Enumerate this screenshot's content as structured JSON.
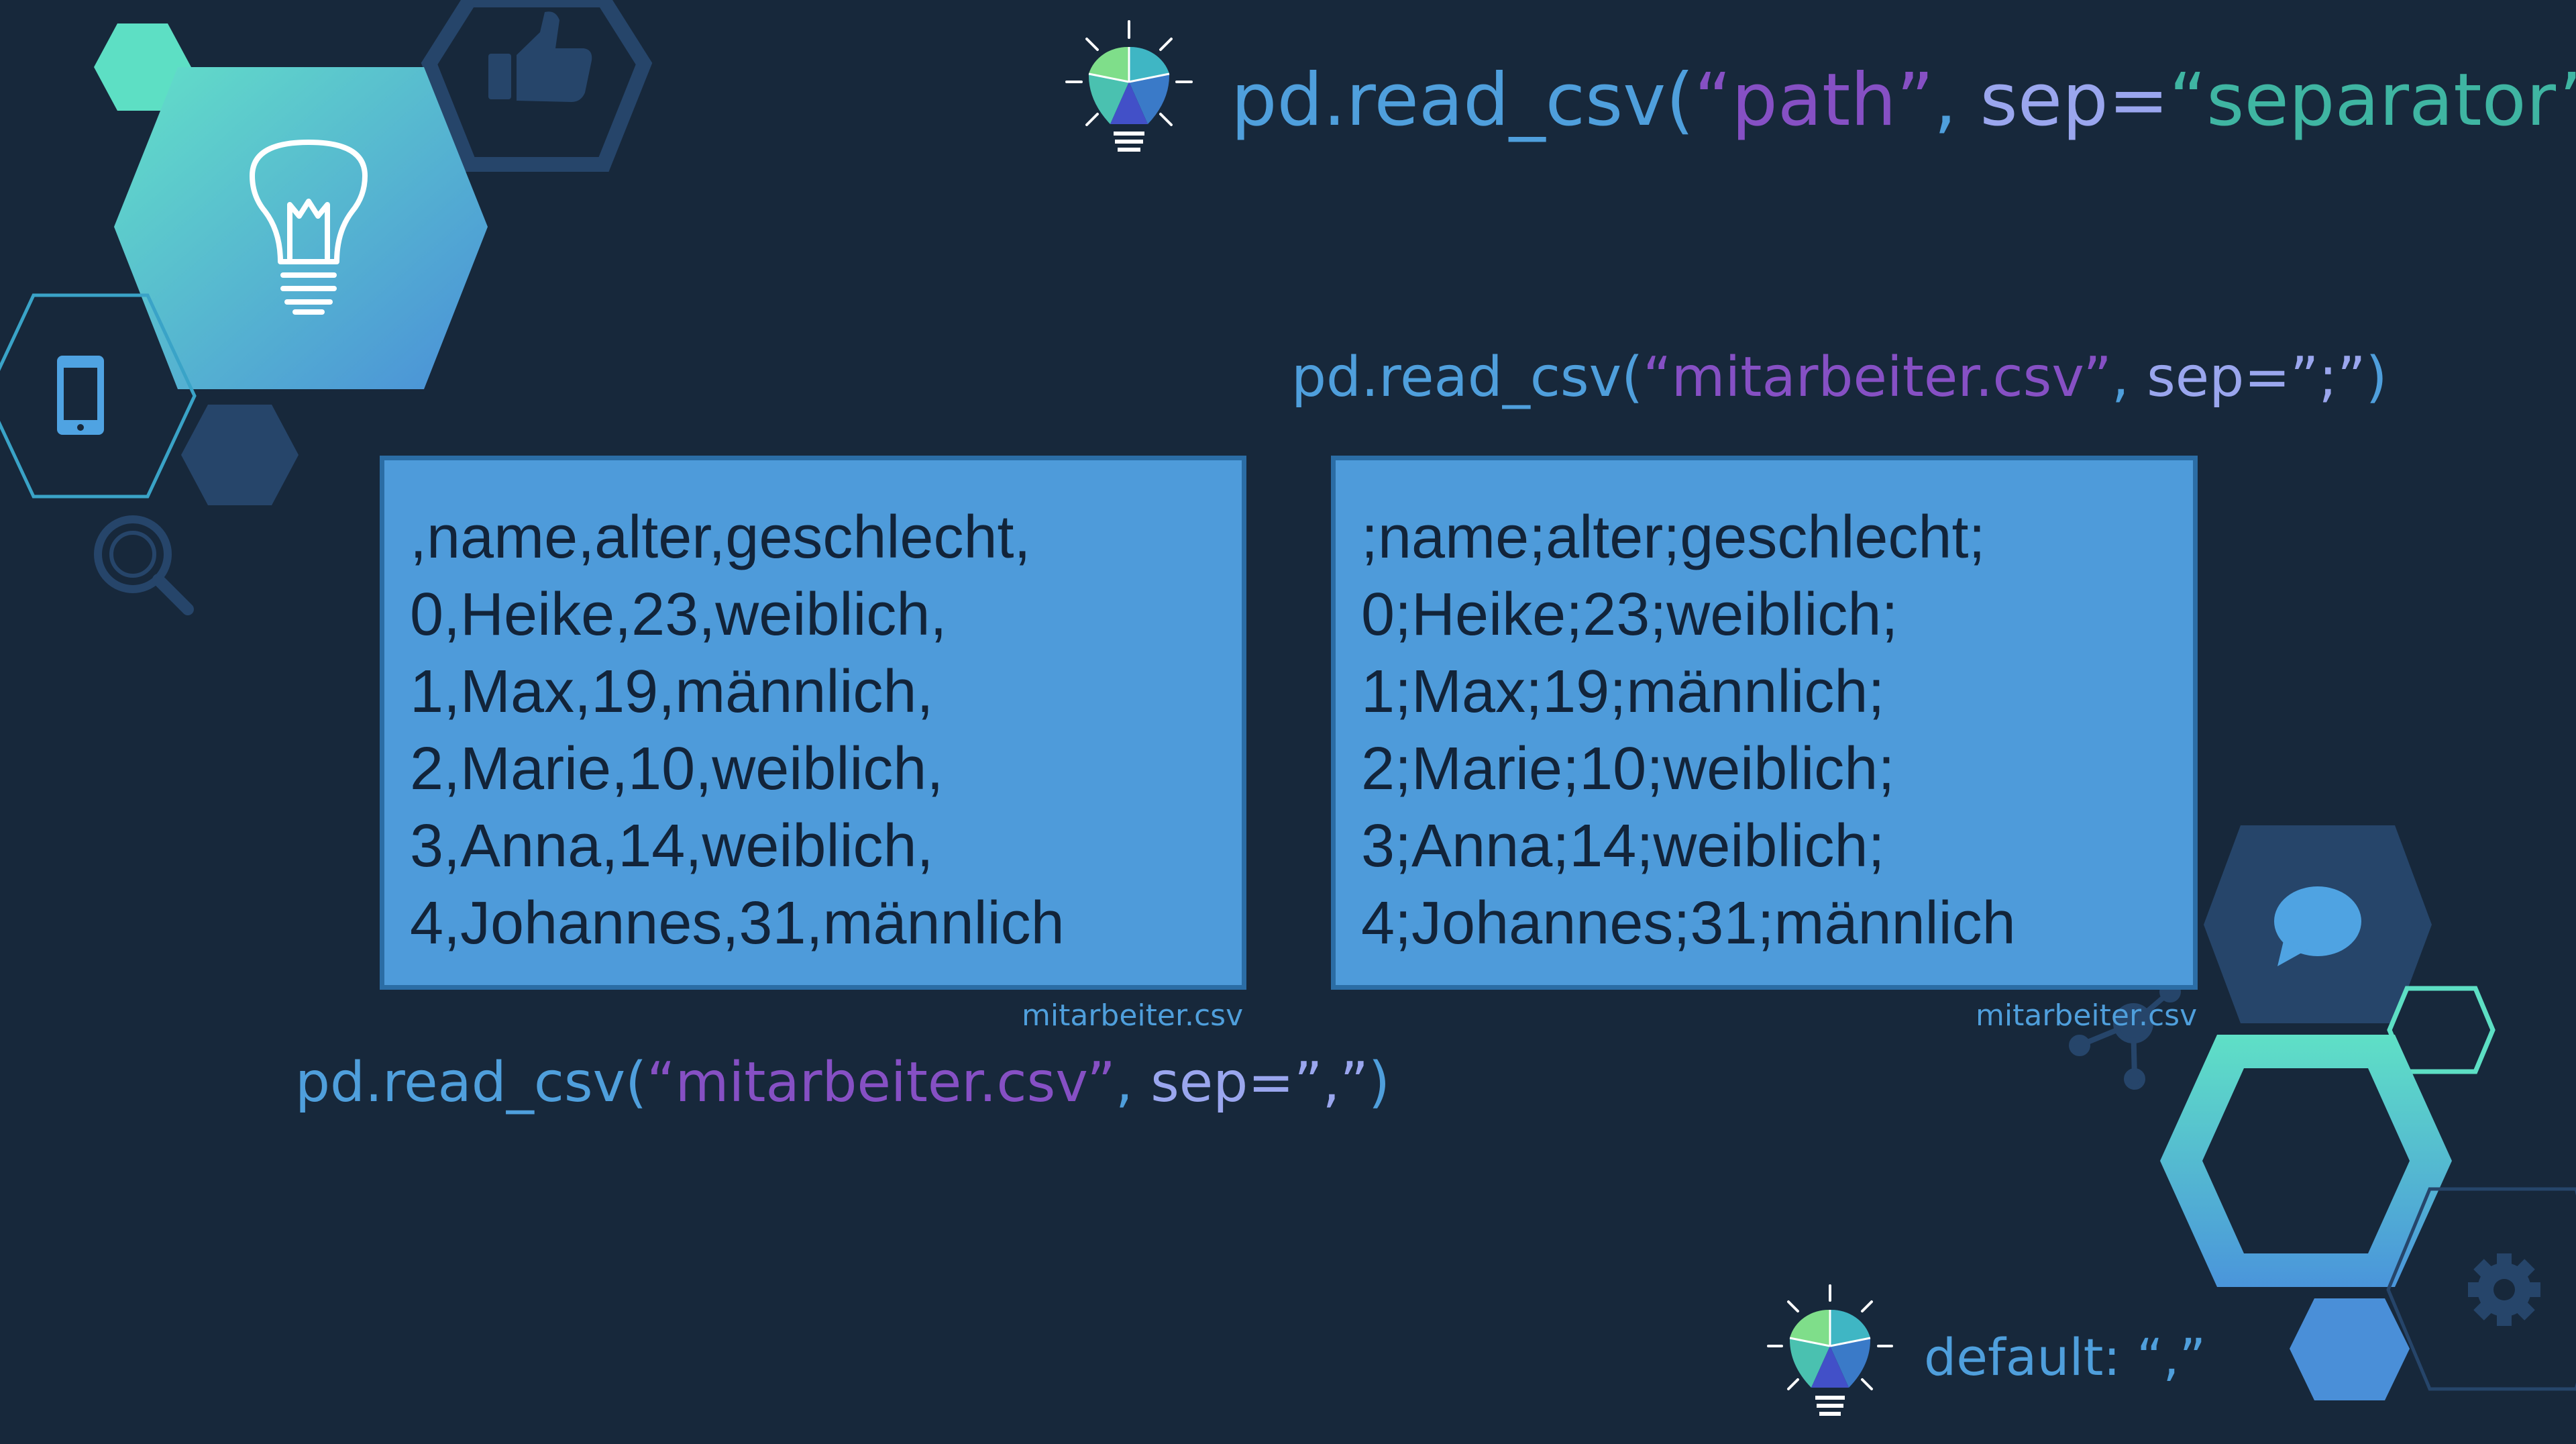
{
  "formula": {
    "fn": "pd.read_csv(",
    "path": "“path”",
    "comma_space": ", ",
    "sep_key": "sep=",
    "sep_value": "“separator”",
    "close": ")"
  },
  "semicolon_example": {
    "fn": "pd.read_csv(",
    "file": "“mitarbeiter.csv”",
    "comma_space": ", ",
    "sep_key": "sep=",
    "sep_value": "”;”",
    "close": ")",
    "lines": [
      ";name;alter;geschlecht;",
      "0;Heike;23;weiblich;",
      "1;Max;19;männlich;",
      "2;Marie;10;weiblich;",
      "3;Anna;14;weiblich;",
      "4;Johannes;31;männlich"
    ],
    "file_label": "mitarbeiter.csv"
  },
  "comma_example": {
    "fn": "pd.read_csv(",
    "file": "“mitarbeiter.csv”",
    "comma_space": ", ",
    "sep_key": "sep=",
    "sep_value": "”,”",
    "close": ")",
    "lines": [
      ",name,alter,geschlecht,",
      "0,Heike,23,weiblich,",
      "1,Max,19,männlich,",
      "2,Marie,10,weiblich,",
      "3,Anna,14,weiblich,",
      "4,Johannes,31,männlich"
    ],
    "file_label": "mitarbeiter.csv"
  },
  "default_note": "default: “,”",
  "colors": {
    "background": "#17283b",
    "box_fill": "#4e9bda",
    "box_border": "#2b6da5",
    "code_blue": "#4f9fdc",
    "string_purple": "#8650c4",
    "sep_lavender": "#9aa6ee",
    "sep_value_teal": "#3fb5a2",
    "hex_teal": "#5fdbc8",
    "hex_blue": "#4a8fd8"
  },
  "icons": [
    "lightbulb-icon",
    "thumbs-up-icon",
    "smartphone-icon",
    "magnifier-icon",
    "chat-bubble-icon",
    "gear-icon",
    "network-icon",
    "colorful-lightbulb-icon"
  ]
}
